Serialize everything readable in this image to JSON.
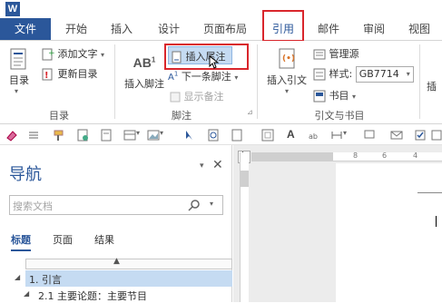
{
  "app": {
    "logo_letter": "W"
  },
  "tabs": [
    "文件",
    "开始",
    "插入",
    "设计",
    "页面布局",
    "引用",
    "邮件",
    "审阅",
    "视图"
  ],
  "ribbon": {
    "toc": {
      "label": "目录",
      "add_text": "添加文字",
      "update_toc": "更新目录",
      "group": "目录"
    },
    "footnotes": {
      "insert_footnote": "插入脚注",
      "insert_endnote": "插入尾注",
      "next_footnote": "下一条脚注",
      "show_notes": "显示备注",
      "group": "脚注",
      "ab_glyph": "AB",
      "ab_sup": "1"
    },
    "citations": {
      "insert_citation": "插入引文",
      "manage_sources": "管理源",
      "style_label": "样式:",
      "style_value": "GB7714",
      "bibliography": "书目",
      "group": "引文与书目",
      "cut_off": "插"
    }
  },
  "nav": {
    "title": "导航",
    "search_placeholder": "搜索文档",
    "tabs": [
      "标题",
      "页面",
      "结果"
    ],
    "items": [
      "1. 引言",
      "2.1 主要论题：主要节目"
    ]
  },
  "ruler": {
    "mark1": "8",
    "mark2": "6",
    "mark3": "4"
  },
  "colors": {
    "accent": "#2b579a",
    "highlight": "#d9262c",
    "selected": "#c5dbf2"
  }
}
